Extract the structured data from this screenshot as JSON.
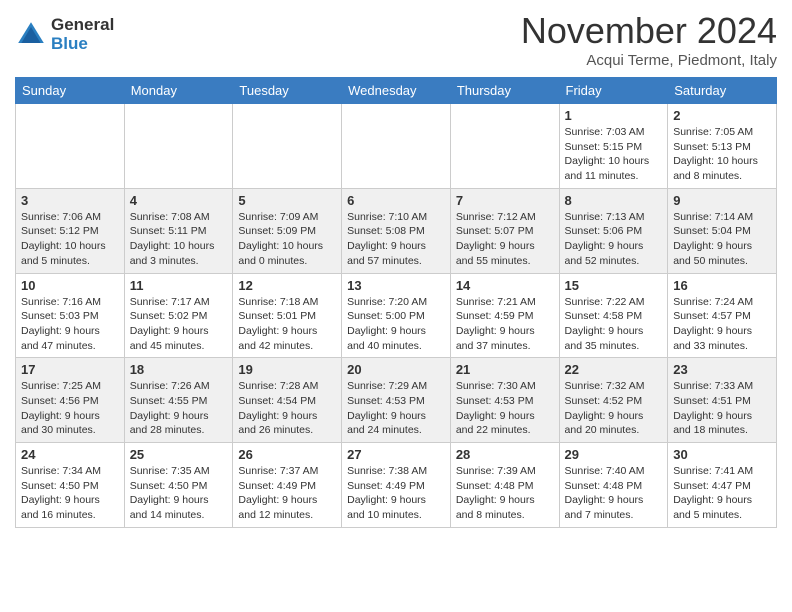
{
  "header": {
    "logo_general": "General",
    "logo_blue": "Blue",
    "month": "November 2024",
    "location": "Acqui Terme, Piedmont, Italy"
  },
  "days_of_week": [
    "Sunday",
    "Monday",
    "Tuesday",
    "Wednesday",
    "Thursday",
    "Friday",
    "Saturday"
  ],
  "weeks": [
    [
      {
        "day": "",
        "info": ""
      },
      {
        "day": "",
        "info": ""
      },
      {
        "day": "",
        "info": ""
      },
      {
        "day": "",
        "info": ""
      },
      {
        "day": "",
        "info": ""
      },
      {
        "day": "1",
        "info": "Sunrise: 7:03 AM\nSunset: 5:15 PM\nDaylight: 10 hours and 11 minutes."
      },
      {
        "day": "2",
        "info": "Sunrise: 7:05 AM\nSunset: 5:13 PM\nDaylight: 10 hours and 8 minutes."
      }
    ],
    [
      {
        "day": "3",
        "info": "Sunrise: 7:06 AM\nSunset: 5:12 PM\nDaylight: 10 hours and 5 minutes."
      },
      {
        "day": "4",
        "info": "Sunrise: 7:08 AM\nSunset: 5:11 PM\nDaylight: 10 hours and 3 minutes."
      },
      {
        "day": "5",
        "info": "Sunrise: 7:09 AM\nSunset: 5:09 PM\nDaylight: 10 hours and 0 minutes."
      },
      {
        "day": "6",
        "info": "Sunrise: 7:10 AM\nSunset: 5:08 PM\nDaylight: 9 hours and 57 minutes."
      },
      {
        "day": "7",
        "info": "Sunrise: 7:12 AM\nSunset: 5:07 PM\nDaylight: 9 hours and 55 minutes."
      },
      {
        "day": "8",
        "info": "Sunrise: 7:13 AM\nSunset: 5:06 PM\nDaylight: 9 hours and 52 minutes."
      },
      {
        "day": "9",
        "info": "Sunrise: 7:14 AM\nSunset: 5:04 PM\nDaylight: 9 hours and 50 minutes."
      }
    ],
    [
      {
        "day": "10",
        "info": "Sunrise: 7:16 AM\nSunset: 5:03 PM\nDaylight: 9 hours and 47 minutes."
      },
      {
        "day": "11",
        "info": "Sunrise: 7:17 AM\nSunset: 5:02 PM\nDaylight: 9 hours and 45 minutes."
      },
      {
        "day": "12",
        "info": "Sunrise: 7:18 AM\nSunset: 5:01 PM\nDaylight: 9 hours and 42 minutes."
      },
      {
        "day": "13",
        "info": "Sunrise: 7:20 AM\nSunset: 5:00 PM\nDaylight: 9 hours and 40 minutes."
      },
      {
        "day": "14",
        "info": "Sunrise: 7:21 AM\nSunset: 4:59 PM\nDaylight: 9 hours and 37 minutes."
      },
      {
        "day": "15",
        "info": "Sunrise: 7:22 AM\nSunset: 4:58 PM\nDaylight: 9 hours and 35 minutes."
      },
      {
        "day": "16",
        "info": "Sunrise: 7:24 AM\nSunset: 4:57 PM\nDaylight: 9 hours and 33 minutes."
      }
    ],
    [
      {
        "day": "17",
        "info": "Sunrise: 7:25 AM\nSunset: 4:56 PM\nDaylight: 9 hours and 30 minutes."
      },
      {
        "day": "18",
        "info": "Sunrise: 7:26 AM\nSunset: 4:55 PM\nDaylight: 9 hours and 28 minutes."
      },
      {
        "day": "19",
        "info": "Sunrise: 7:28 AM\nSunset: 4:54 PM\nDaylight: 9 hours and 26 minutes."
      },
      {
        "day": "20",
        "info": "Sunrise: 7:29 AM\nSunset: 4:53 PM\nDaylight: 9 hours and 24 minutes."
      },
      {
        "day": "21",
        "info": "Sunrise: 7:30 AM\nSunset: 4:53 PM\nDaylight: 9 hours and 22 minutes."
      },
      {
        "day": "22",
        "info": "Sunrise: 7:32 AM\nSunset: 4:52 PM\nDaylight: 9 hours and 20 minutes."
      },
      {
        "day": "23",
        "info": "Sunrise: 7:33 AM\nSunset: 4:51 PM\nDaylight: 9 hours and 18 minutes."
      }
    ],
    [
      {
        "day": "24",
        "info": "Sunrise: 7:34 AM\nSunset: 4:50 PM\nDaylight: 9 hours and 16 minutes."
      },
      {
        "day": "25",
        "info": "Sunrise: 7:35 AM\nSunset: 4:50 PM\nDaylight: 9 hours and 14 minutes."
      },
      {
        "day": "26",
        "info": "Sunrise: 7:37 AM\nSunset: 4:49 PM\nDaylight: 9 hours and 12 minutes."
      },
      {
        "day": "27",
        "info": "Sunrise: 7:38 AM\nSunset: 4:49 PM\nDaylight: 9 hours and 10 minutes."
      },
      {
        "day": "28",
        "info": "Sunrise: 7:39 AM\nSunset: 4:48 PM\nDaylight: 9 hours and 8 minutes."
      },
      {
        "day": "29",
        "info": "Sunrise: 7:40 AM\nSunset: 4:48 PM\nDaylight: 9 hours and 7 minutes."
      },
      {
        "day": "30",
        "info": "Sunrise: 7:41 AM\nSunset: 4:47 PM\nDaylight: 9 hours and 5 minutes."
      }
    ]
  ]
}
